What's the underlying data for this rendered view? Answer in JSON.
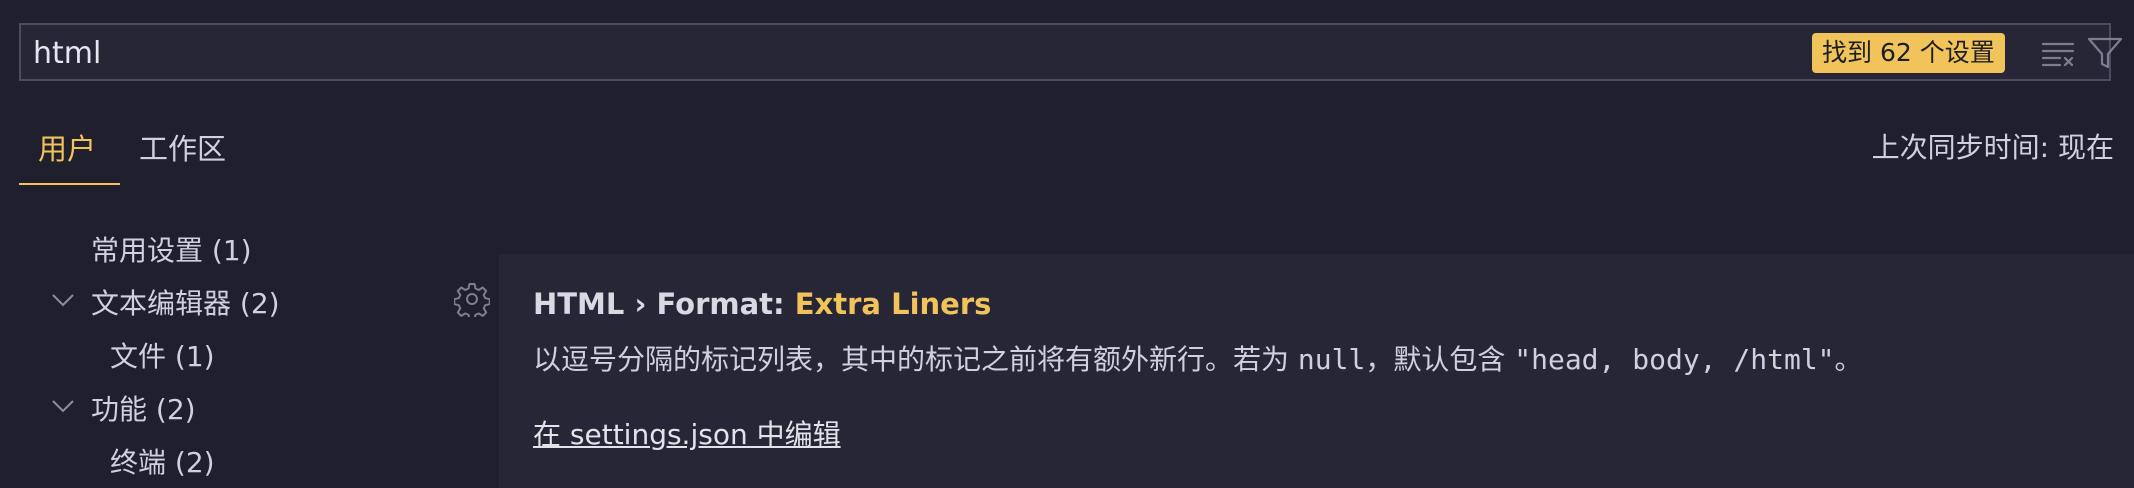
{
  "search": {
    "value": "html",
    "result_badge": "找到 62 个设置"
  },
  "tabs": [
    {
      "label": "用户",
      "active": true
    },
    {
      "label": "工作区",
      "active": false
    }
  ],
  "sync_status": "上次同步时间: 现在",
  "tree": [
    {
      "label": "常用设置 (1)",
      "expandable": false
    },
    {
      "label": "文本编辑器 (2)",
      "expandable": true
    },
    {
      "label": "文件 (1)",
      "expandable": false
    },
    {
      "label": "功能 (2)",
      "expandable": true
    },
    {
      "label": "终端 (2)",
      "expandable": false
    }
  ],
  "setting": {
    "category": "HTML › Format: ",
    "name": "Extra Liners",
    "desc_part1": "以逗号分隔的标记列表，其中的标记之前将有额外新行。若为 ",
    "desc_code1": "null",
    "desc_part2": "，默认包含 ",
    "desc_code2": "\"head, body, /html\"",
    "desc_part3": "。",
    "edit_link": "在 settings.json 中编辑"
  },
  "colors": {
    "accent": "#f0c35b",
    "background": "#1f1f2d",
    "panel": "#262636"
  },
  "icons": [
    "clear-filter-icon",
    "filter-icon",
    "chevron-down-icon",
    "gear-icon"
  ]
}
